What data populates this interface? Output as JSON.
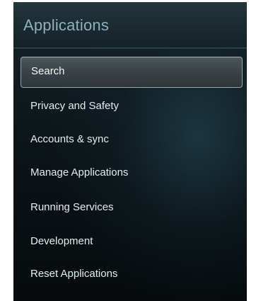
{
  "header": {
    "title": "Applications"
  },
  "menu": {
    "selected_index": 0,
    "items": [
      {
        "label": "Search"
      },
      {
        "label": "Privacy and Safety"
      },
      {
        "label": "Accounts & sync"
      },
      {
        "label": "Manage Applications"
      },
      {
        "label": "Running Services"
      },
      {
        "label": "Development"
      },
      {
        "label": "Reset Applications"
      }
    ]
  },
  "colors": {
    "header_text": "#8fb0be",
    "item_text": "#e4ecef",
    "background_dark": "#060a0c",
    "selection_border": "#9aa4a8"
  }
}
